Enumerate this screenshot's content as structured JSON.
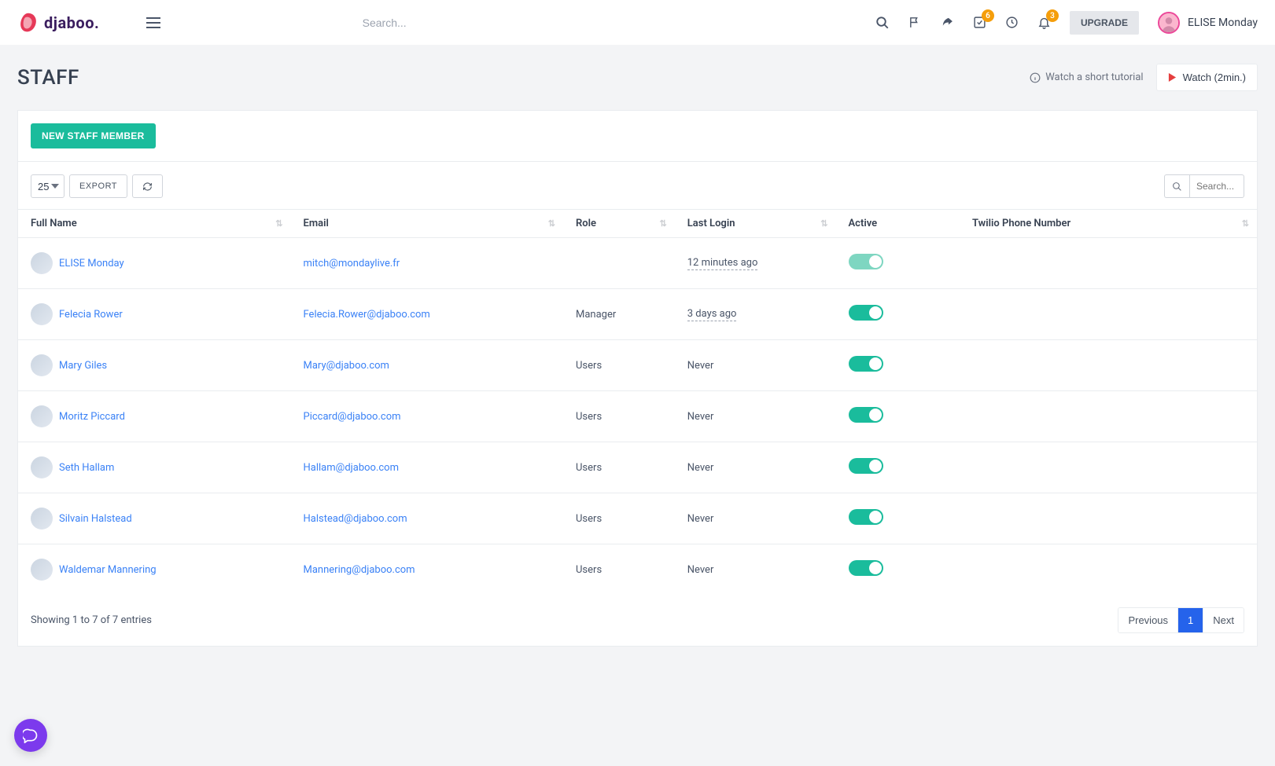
{
  "brand": {
    "name": "djaboo."
  },
  "topbar": {
    "search_placeholder": "Search...",
    "badges": {
      "tasks": "6",
      "notifications": "3"
    },
    "upgrade_label": "UPGRADE",
    "user_name": "ELISE Monday"
  },
  "page": {
    "title": "STAFF",
    "tutorial_text": "Watch a short tutorial",
    "watch_button": "Watch (2min.)"
  },
  "actions": {
    "new_staff": "NEW STAFF MEMBER",
    "page_size": "25",
    "export": "EXPORT",
    "table_search_placeholder": "Search..."
  },
  "columns": {
    "full_name": "Full Name",
    "email": "Email",
    "role": "Role",
    "last_login": "Last Login",
    "active": "Active",
    "twilio": "Twilio Phone Number"
  },
  "rows": [
    {
      "name": "ELISE Monday",
      "email": "mitch@mondaylive.fr",
      "role": "",
      "last_login": "12 minutes ago",
      "login_dashed": true,
      "active_light": true,
      "twilio": ""
    },
    {
      "name": "Felecia Rower",
      "email": "Felecia.Rower@djaboo.com",
      "role": "Manager",
      "last_login": "3 days ago",
      "login_dashed": true,
      "active_light": false,
      "twilio": ""
    },
    {
      "name": "Mary Giles",
      "email": "Mary@djaboo.com",
      "role": "Users",
      "last_login": "Never",
      "login_dashed": false,
      "active_light": false,
      "twilio": ""
    },
    {
      "name": "Moritz Piccard",
      "email": "Piccard@djaboo.com",
      "role": "Users",
      "last_login": "Never",
      "login_dashed": false,
      "active_light": false,
      "twilio": ""
    },
    {
      "name": "Seth Hallam",
      "email": "Hallam@djaboo.com",
      "role": "Users",
      "last_login": "Never",
      "login_dashed": false,
      "active_light": false,
      "twilio": ""
    },
    {
      "name": "Silvain Halstead",
      "email": "Halstead@djaboo.com",
      "role": "Users",
      "last_login": "Never",
      "login_dashed": false,
      "active_light": false,
      "twilio": ""
    },
    {
      "name": "Waldemar Mannering",
      "email": "Mannering@djaboo.com",
      "role": "Users",
      "last_login": "Never",
      "login_dashed": false,
      "active_light": false,
      "twilio": ""
    }
  ],
  "footer": {
    "summary": "Showing 1 to 7 of 7 entries",
    "prev": "Previous",
    "page": "1",
    "next": "Next"
  }
}
